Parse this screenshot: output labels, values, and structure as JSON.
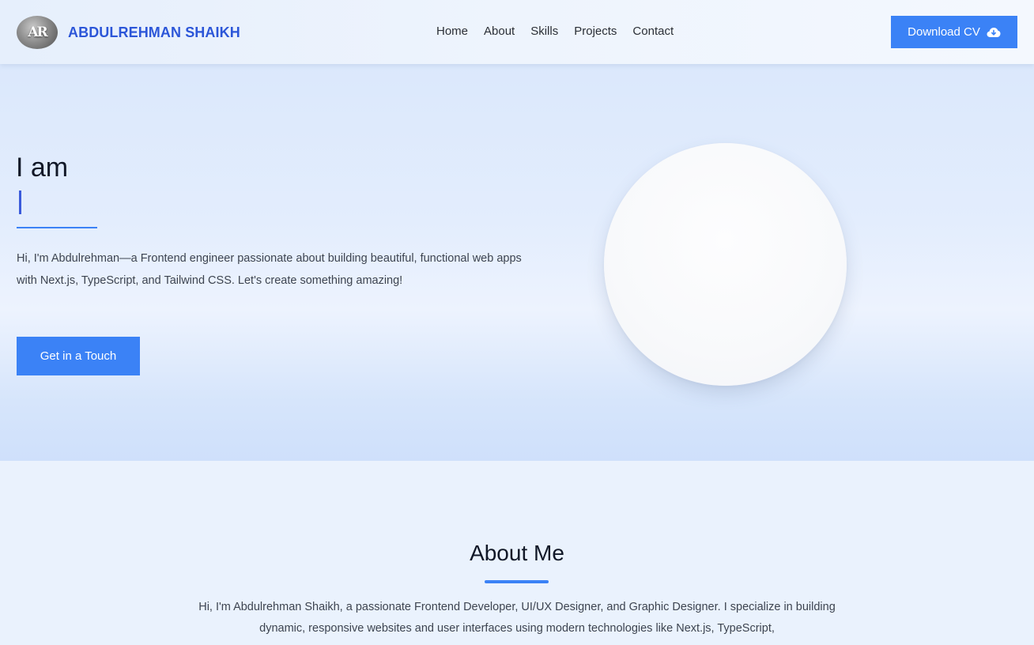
{
  "navbar": {
    "logo_initials": "AR",
    "brand_name": "ABDULREHMAN SHAIKH",
    "links": [
      "Home",
      "About",
      "Skills",
      "Projects",
      "Contact"
    ],
    "cv_button_label": "Download CV",
    "cv_icon": "cloud-download-icon"
  },
  "hero": {
    "title": "I am",
    "typed_text": "",
    "intro": "Hi, I'm Abdulrehman—a Frontend engineer passionate about building beautiful, functional web apps with Next.js, TypeScript, and Tailwind CSS. Let's create something amazing!",
    "cta_label": "Get in a Touch"
  },
  "about": {
    "title": "About Me",
    "text": "Hi, I'm Abdulrehman Shaikh, a passionate Frontend Developer, UI/UX Designer, and Graphic Designer. I specialize in building dynamic, responsive websites and user interfaces using modern technologies like Next.js, TypeScript,"
  },
  "colors": {
    "accent": "#3b82f6",
    "brand": "#2c56d8"
  }
}
